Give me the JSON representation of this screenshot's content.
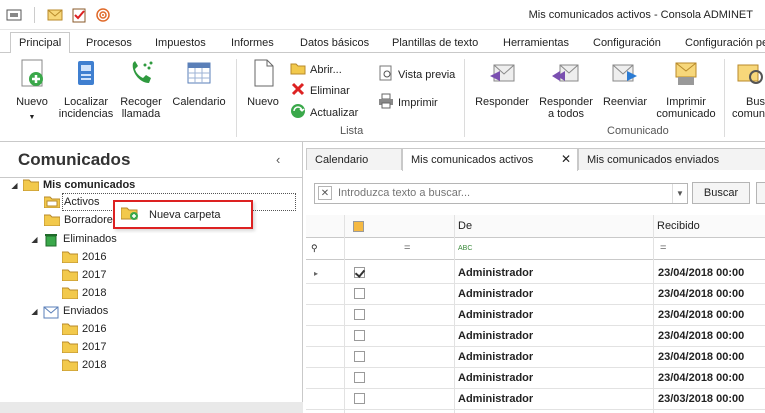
{
  "window": {
    "title": "Mis comunicados activos - Consola ADMINET"
  },
  "ribbon_tabs": [
    "Principal",
    "Procesos",
    "Impuestos",
    "Informes",
    "Datos básicos",
    "Plantillas de texto",
    "Herramientas",
    "Configuración",
    "Configuración pe"
  ],
  "ribbon": {
    "nuevo": "Nuevo",
    "localizar": [
      "Localizar",
      "incidencias"
    ],
    "recoger": [
      "Recoger",
      "llamada"
    ],
    "calendario": "Calendario",
    "nuevo2": "Nuevo",
    "abrir": "Abrir...",
    "eliminar": "Eliminar",
    "actualizar": "Actualizar",
    "vista_previa": "Vista previa",
    "imprimir": "Imprimir",
    "group_lista": "Lista",
    "responder": "Responder",
    "responder_todos": [
      "Responder",
      "a todos"
    ],
    "reenviar": "Reenviar",
    "imprimir_com": [
      "Imprimir",
      "comunicado"
    ],
    "buscar": [
      "Bus",
      "comun"
    ],
    "group_comunicado": "Comunicado"
  },
  "left_panel": {
    "title": "Comunicados",
    "collapse": "‹",
    "tree": {
      "root": "Mis comunicados",
      "activos": "Activos",
      "borradores": "Borradore",
      "eliminados": "Eliminados",
      "el_2016": "2016",
      "el_2017": "2017",
      "el_2018": "2018",
      "enviados": "Enviados",
      "en_2016": "2016",
      "en_2017": "2017",
      "en_2018": "2018"
    }
  },
  "context_menu": {
    "nueva_carpeta": "Nueva carpeta"
  },
  "doc_tabs": {
    "calendario": "Calendario",
    "activos": "Mis comunicados activos",
    "enviados": "Mis comunicados enviados"
  },
  "search": {
    "placeholder": "Introduzca texto a buscar...",
    "button": "Buscar"
  },
  "grid": {
    "col_de": "De",
    "col_recibido": "Recibido",
    "filter_eq1": "=",
    "filter_abc": "ABC",
    "filter_eq2": "=",
    "rows": [
      {
        "de": "Administrador",
        "recibido": "23/04/2018 00:00",
        "checked": true
      },
      {
        "de": "Administrador",
        "recibido": "23/04/2018 00:00",
        "checked": false
      },
      {
        "de": "Administrador",
        "recibido": "23/04/2018 00:00",
        "checked": false
      },
      {
        "de": "Administrador",
        "recibido": "23/04/2018 00:00",
        "checked": false
      },
      {
        "de": "Administrador",
        "recibido": "23/04/2018 00:00",
        "checked": false
      },
      {
        "de": "Administrador",
        "recibido": "23/04/2018 00:00",
        "checked": false
      },
      {
        "de": "Administrador",
        "recibido": "23/03/2018 00:00",
        "checked": false
      }
    ]
  },
  "colors": {
    "accent": "#2b7bd3",
    "folder": "#f2c94c",
    "highlight_border": "#dd2222"
  }
}
